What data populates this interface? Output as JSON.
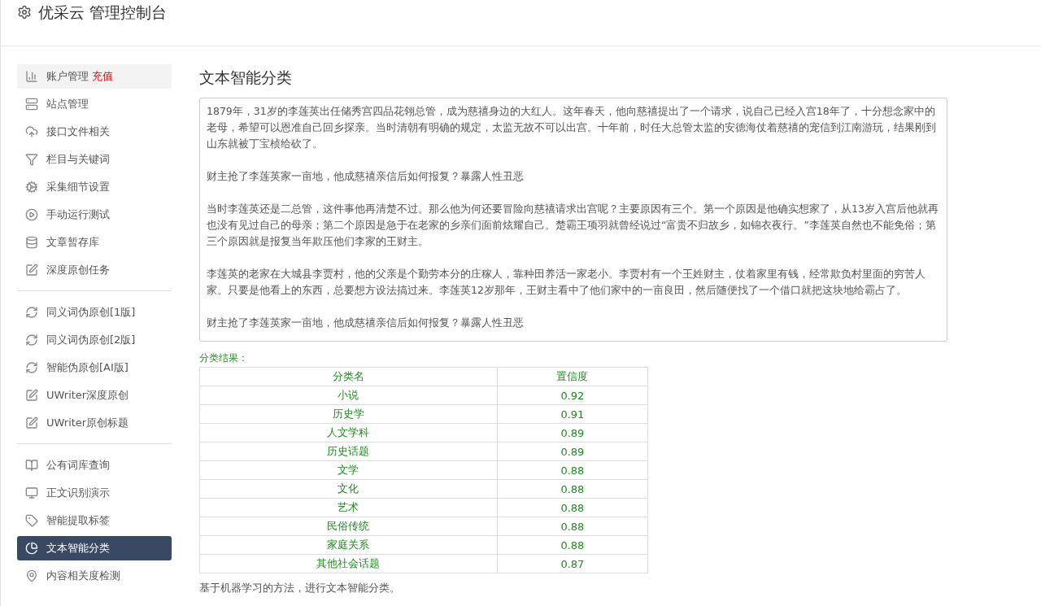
{
  "header": {
    "title": "优采云 管理控制台"
  },
  "sidebar": {
    "groups": [
      {
        "items": [
          {
            "label": "账户管理",
            "badge": "充值",
            "highlighted": true,
            "selected": false
          },
          {
            "label": "站点管理",
            "highlighted": false,
            "selected": false
          },
          {
            "label": "接口文件相关",
            "highlighted": false,
            "selected": false
          },
          {
            "label": "栏目与关键词",
            "highlighted": false,
            "selected": false
          },
          {
            "label": "采集细节设置",
            "highlighted": false,
            "selected": false
          },
          {
            "label": "手动运行测试",
            "highlighted": false,
            "selected": false
          },
          {
            "label": "文章暂存库",
            "highlighted": false,
            "selected": false
          },
          {
            "label": "深度原创任务",
            "highlighted": false,
            "selected": false
          }
        ]
      },
      {
        "items": [
          {
            "label": "同义词伪原创[1版]",
            "highlighted": false,
            "selected": false
          },
          {
            "label": "同义词伪原创[2版]",
            "highlighted": false,
            "selected": false
          },
          {
            "label": "智能伪原创[AI版]",
            "highlighted": false,
            "selected": false
          },
          {
            "label": "UWriter深度原创",
            "highlighted": false,
            "selected": false
          },
          {
            "label": "UWriter原创标题",
            "highlighted": false,
            "selected": false
          }
        ]
      },
      {
        "items": [
          {
            "label": "公有词库查询",
            "highlighted": false,
            "selected": false
          },
          {
            "label": "正文识别演示",
            "highlighted": false,
            "selected": false
          },
          {
            "label": "智能提取标签",
            "highlighted": false,
            "selected": false
          },
          {
            "label": "文本智能分类",
            "highlighted": false,
            "selected": true
          },
          {
            "label": "内容相关度检测",
            "highlighted": false,
            "selected": false
          }
        ]
      }
    ]
  },
  "main": {
    "title": "文本智能分类",
    "article": {
      "paragraphs": [
        "1879年，31岁的李莲英出任储秀宫四品花翎总管，成为慈禧身边的大红人。这年春天，他向慈禧提出了一个请求，说自己已经入宫18年了，十分想念家中的老母，希望可以恩准自己回乡探亲。当时清朝有明确的规定，太监无故不可以出宫。十年前，时任大总管太监的安德海仗着慈禧的宠信到江南游玩，结果刚到山东就被丁宝桢给砍了。",
        "财主抢了李莲英家一亩地，他成慈禧亲信后如何报复？暴露人性丑恶",
        "当时李莲英还是二总管，这件事他再清楚不过。那么他为何还要冒险向慈禧请求出宫呢？主要原因有三个。第一个原因是他确实想家了，从13岁入宫后他就再也没有见过自己的母亲；第二个原因是急于在老家的乡亲们面前炫耀自己。楚霸王项羽就曾经说过“富贵不归故乡，如锦衣夜行。”李莲英自然也不能免俗；第三个原因就是报复当年欺压他们李家的王财主。",
        "李莲英的老家在大城县李贾村，他的父亲是个勤劳本分的庄稼人，靠种田养活一家老小。李贾村有一个王姓财主，仗着家里有钱，经常欺负村里面的穷苦人家。只要是他看上的东西，总要想方设法搞过来。李莲英12岁那年，王财主看中了他们家中的一亩良田，然后随便找了一个借口就把这块地给霸占了。",
        "财主抢了李莲英家一亩地，他成慈禧亲信后如何报复？暴露人性丑恶"
      ]
    },
    "result_label": "分类结果：",
    "table": {
      "columns": [
        "分类名",
        "置信度"
      ],
      "rows": [
        [
          "小说",
          "0.92"
        ],
        [
          "历史学",
          "0.91"
        ],
        [
          "人文学科",
          "0.89"
        ],
        [
          "历史话题",
          "0.89"
        ],
        [
          "文学",
          "0.88"
        ],
        [
          "文化",
          "0.88"
        ],
        [
          "艺术",
          "0.88"
        ],
        [
          "民俗传统",
          "0.88"
        ],
        [
          "家庭关系",
          "0.88"
        ],
        [
          "其他社会话题",
          "0.87"
        ]
      ]
    },
    "note": "基于机器学习的方法，进行文本智能分类。"
  }
}
